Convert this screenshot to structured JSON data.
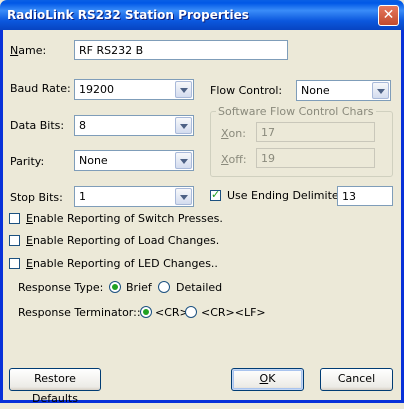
{
  "window": {
    "title": "RadioLink RS232 Station Properties",
    "close_glyph": "✕"
  },
  "name": {
    "label_u": "N",
    "label_rest": "ame:",
    "value": "RF RS232 B"
  },
  "baud_rate": {
    "label": "Baud Rate:",
    "value": "19200"
  },
  "data_bits": {
    "label": "Data Bits:",
    "value": "8"
  },
  "parity": {
    "label": "Parity:",
    "value": "None"
  },
  "stop_bits": {
    "label": "Stop Bits:",
    "value": "1"
  },
  "flow_control": {
    "label": "Flow Control:",
    "value": "None"
  },
  "software_flow": {
    "group_label": "Software Flow Control Chars",
    "xon_u": "X",
    "xon_rest": "on:",
    "xon_value": "17",
    "xoff_u": "X",
    "xoff_rest": "off:",
    "xoff_value": "19"
  },
  "ending_delimiter": {
    "label": "Use Ending Delimiter",
    "checked": true,
    "value": "13"
  },
  "checks": {
    "switch": {
      "label_u": "E",
      "label_rest": "nable  Reporting of Switch Presses.",
      "checked": false
    },
    "load": {
      "label_u": "E",
      "label_rest": "nable Reporting of Load Changes.",
      "checked": false
    },
    "led": {
      "label_u": "E",
      "label_rest": "nable Reporting of LED Changes..",
      "checked": false
    }
  },
  "response_type": {
    "label": "Response Type:",
    "options": [
      "Brief",
      "Detailed"
    ],
    "selected": "Brief"
  },
  "response_terminator": {
    "label": "Response Terminator::",
    "options": [
      "<CR>",
      "<CR><LF>"
    ],
    "selected": "<CR>"
  },
  "buttons": {
    "restore": "Restore Defaults",
    "ok_u": "O",
    "ok_rest": "K",
    "cancel": "Cancel"
  }
}
